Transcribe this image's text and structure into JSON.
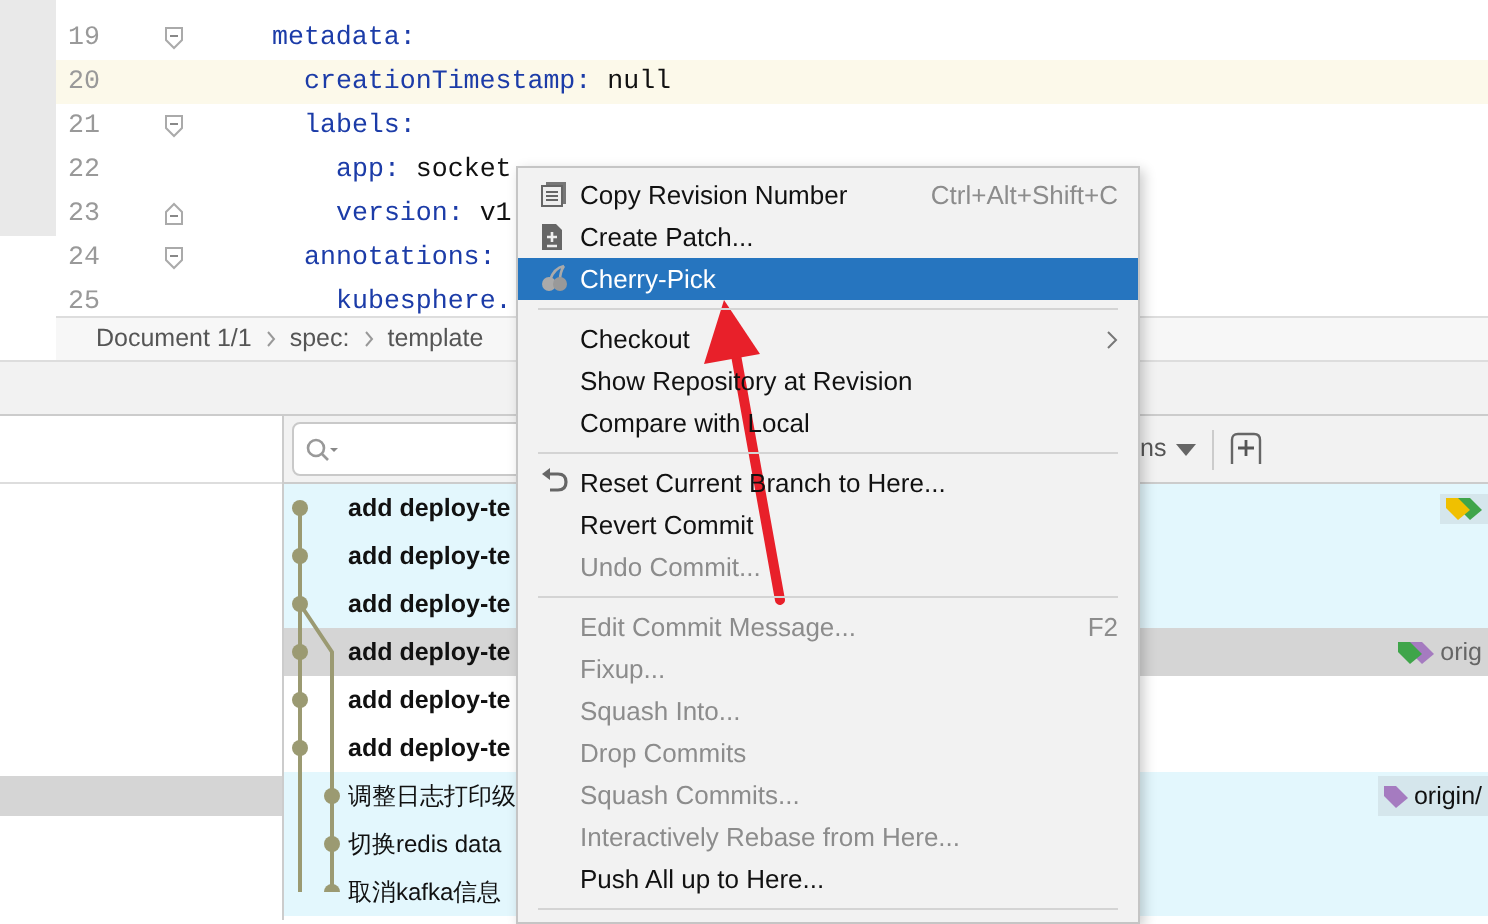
{
  "editor": {
    "lines": [
      {
        "number": "19",
        "key": "metadata:",
        "kind": "fold-start",
        "current": false,
        "children": [
          {
            "number": "20",
            "key": "creationTimestamp:",
            "value": "null",
            "kind": "plain",
            "current": true
          },
          {
            "number": "21",
            "key": "labels:",
            "kind": "fold-start",
            "current": false,
            "children": [
              {
                "number": "22",
                "key": "app:",
                "value": "socket",
                "kind": "plain",
                "current": false
              },
              {
                "number": "23",
                "key": "version:",
                "value": "v1",
                "kind": "fold-end",
                "current": false
              }
            ]
          },
          {
            "number": "24",
            "key": "annotations:",
            "kind": "fold-start",
            "current": false,
            "children": [
              {
                "number": "25",
                "key": "kubesphere.",
                "kind": "plain",
                "current": false
              }
            ]
          }
        ]
      }
    ],
    "breadcrumb": [
      "Document 1/1",
      "spec:",
      "template"
    ]
  },
  "log": {
    "filter_text": "ns",
    "selected_row_shown": true,
    "commits": [
      {
        "message": "add deploy-te",
        "bold": true,
        "kind": "main",
        "selected": false,
        "in_current_branch": true,
        "tags": [
          {
            "color": "#f0c000"
          },
          {
            "color": "#3fa54a"
          }
        ]
      },
      {
        "message": "add deploy-te",
        "bold": true,
        "kind": "main",
        "selected": false,
        "in_current_branch": true
      },
      {
        "message": "add deploy-te",
        "bold": true,
        "kind": "fork",
        "selected": false,
        "in_current_branch": true
      },
      {
        "message": "add deploy-te",
        "bold": true,
        "kind": "main",
        "selected": true,
        "tags": [
          {
            "color": "#3fa54a"
          },
          {
            "color": "#a57bc0"
          }
        ],
        "ref_label": "orig"
      },
      {
        "message": "add deploy-te",
        "bold": true,
        "kind": "main",
        "selected": false,
        "in_current_branch": false
      },
      {
        "message": "add deploy-te",
        "bold": true,
        "kind": "main",
        "selected": false,
        "in_current_branch": false
      },
      {
        "message": "调整日志打印级",
        "bold": false,
        "kind": "branch",
        "selected": false,
        "in_current_branch": true,
        "tags": [
          {
            "color": "#a57bc0"
          }
        ],
        "ref_label": "origin/"
      },
      {
        "message": "切换redis data",
        "bold": false,
        "kind": "branch",
        "selected": false,
        "in_current_branch": true
      },
      {
        "message": "取消kafka信息",
        "bold": false,
        "kind": "branch",
        "selected": false,
        "in_current_branch": true
      }
    ]
  },
  "context_menu": {
    "items": [
      {
        "kind": "copy",
        "label": "Copy Revision Number",
        "shortcut": "Ctrl+Alt+Shift+C",
        "disabled": false,
        "selected": false,
        "submenu": false
      },
      {
        "kind": "patch",
        "label": "Create Patch...",
        "disabled": false,
        "selected": false,
        "submenu": false
      },
      {
        "kind": "cherry",
        "label": "Cherry-Pick",
        "disabled": false,
        "selected": true,
        "submenu": false
      },
      {
        "kind": "separator"
      },
      {
        "kind": "plain",
        "label": "Checkout",
        "disabled": false,
        "selected": false,
        "submenu": true
      },
      {
        "kind": "plain",
        "label": "Show Repository at Revision",
        "disabled": false,
        "selected": false,
        "submenu": false
      },
      {
        "kind": "plain",
        "label": "Compare with Local",
        "disabled": false,
        "selected": false,
        "submenu": false
      },
      {
        "kind": "separator"
      },
      {
        "kind": "undo",
        "label": "Reset Current Branch to Here...",
        "disabled": false,
        "selected": false,
        "submenu": false
      },
      {
        "kind": "plain",
        "label": "Revert Commit",
        "disabled": false,
        "selected": false,
        "submenu": false
      },
      {
        "kind": "plain",
        "label": "Undo Commit...",
        "disabled": true,
        "selected": false,
        "submenu": false
      },
      {
        "kind": "separator"
      },
      {
        "kind": "plain",
        "label": "Edit Commit Message...",
        "shortcut": "F2",
        "disabled": true,
        "selected": false,
        "submenu": false
      },
      {
        "kind": "plain",
        "label": "Fixup...",
        "disabled": true,
        "selected": false,
        "submenu": false
      },
      {
        "kind": "plain",
        "label": "Squash Into...",
        "disabled": true,
        "selected": false,
        "submenu": false
      },
      {
        "kind": "plain",
        "label": "Drop Commits",
        "disabled": true,
        "selected": false,
        "submenu": false
      },
      {
        "kind": "plain",
        "label": "Squash Commits...",
        "disabled": true,
        "selected": false,
        "submenu": false
      },
      {
        "kind": "plain",
        "label": "Interactively Rebase from Here...",
        "disabled": true,
        "selected": false,
        "submenu": false
      },
      {
        "kind": "plain",
        "label": "Push All up to Here...",
        "disabled": false,
        "selected": false,
        "submenu": false
      },
      {
        "kind": "separator"
      }
    ]
  },
  "annotation_arrow": {
    "color": "#e8202a"
  }
}
